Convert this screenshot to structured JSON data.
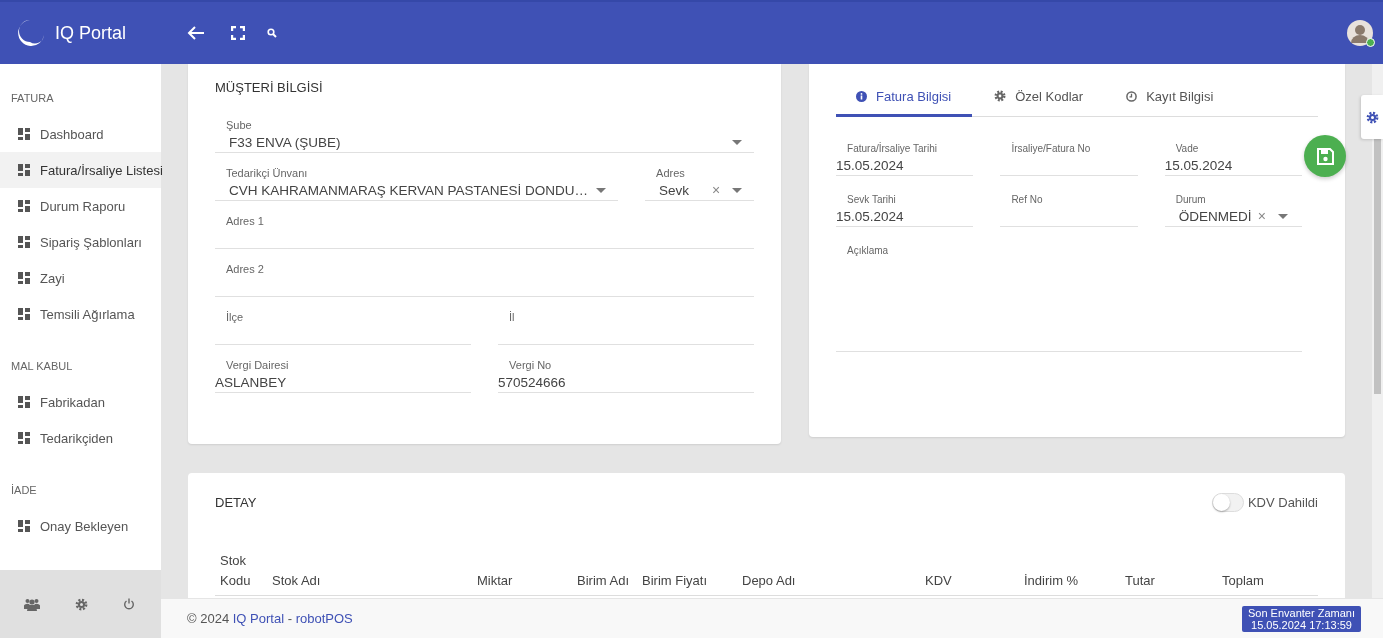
{
  "header": {
    "title": "IQ Portal",
    "user": {
      "online": true
    }
  },
  "sidebar": {
    "sections": [
      {
        "title": "FATURA",
        "items": [
          {
            "label": "Dashboard",
            "selected": false
          },
          {
            "label": "Fatura/İrsaliye Listesi",
            "selected": true
          },
          {
            "label": "Durum Raporu",
            "selected": false
          },
          {
            "label": "Sipariş Şablonları",
            "selected": false
          },
          {
            "label": "Zayi",
            "selected": false
          },
          {
            "label": "Temsili Ağırlama",
            "selected": false
          }
        ]
      },
      {
        "title": "MAL KABUL",
        "items": [
          {
            "label": "Fabrikadan",
            "selected": false
          },
          {
            "label": "Tedarikçiden",
            "selected": false
          }
        ]
      },
      {
        "title": "İADE",
        "items": [
          {
            "label": "Onay Bekleyen",
            "selected": false
          }
        ]
      }
    ]
  },
  "customer": {
    "title": "MÜŞTERİ BİLGİSİ",
    "rows": [
      [
        {
          "label": "Şube",
          "value": "F33 ENVA (ŞUBE)",
          "kind": "select"
        }
      ],
      [
        {
          "label": "Tedarikçi Ünvanı",
          "value": "CVH KAHRAMANMARAŞ KERVAN PASTANESİ DONDU…",
          "kind": "select"
        },
        {
          "label": "Adres",
          "value": "Sevk",
          "kind": "clearable-select",
          "clear": "×"
        }
      ],
      [
        {
          "label": "Adres 1",
          "kind": "text"
        }
      ],
      [
        {
          "label": "Adres 2",
          "kind": "text"
        }
      ],
      [
        {
          "label": "İlçe",
          "kind": "text"
        },
        {
          "label": "İl",
          "kind": "text"
        }
      ],
      [
        {
          "label": "Vergi Dairesi",
          "value": "ASLANBEY",
          "kind": "text"
        },
        {
          "label": "Vergi No",
          "value": "570524666",
          "kind": "text"
        }
      ]
    ]
  },
  "invoice": {
    "tabs": [
      {
        "label": "Fatura Bilgisi",
        "selected": true
      },
      {
        "label": "Özel Kodlar",
        "selected": false
      },
      {
        "label": "Kayıt Bilgisi",
        "selected": false
      }
    ],
    "fields": [
      {
        "label": "Fatura/İrsaliye Tarihi",
        "value": "15.05.2024",
        "kind": "text"
      },
      {
        "label": "İrsaliye/Fatura No",
        "kind": "text"
      },
      {
        "label": "Vade",
        "value": "15.05.2024",
        "kind": "text"
      },
      {
        "label": "Sevk Tarihi",
        "value": "15.05.2024",
        "kind": "text"
      },
      {
        "label": "Ref No",
        "kind": "text"
      },
      {
        "label": "Durum",
        "value": "ÖDENMEDİ",
        "kind": "clearable-select",
        "clear": "×"
      },
      {
        "label": "Açıklama",
        "kind": "textarea"
      }
    ]
  },
  "detail": {
    "title": "DETAY",
    "toggle": {
      "label": "KDV Dahildi",
      "on": false
    },
    "columns": [
      "Stok Kodu",
      "Stok Adı",
      "Miktar",
      "Birim Adı",
      "Birim Fiyatı",
      "Depo Adı",
      "KDV",
      "İndirim %",
      "Tutar",
      "Toplam"
    ]
  },
  "footer": {
    "copyright": "© 2024",
    "links": [
      "IQ Portal",
      "robotPOS"
    ],
    "separator": "-",
    "badge": {
      "label": "Son Envanter Zamanı",
      "time": "15.05.2024 17:13:59"
    }
  }
}
